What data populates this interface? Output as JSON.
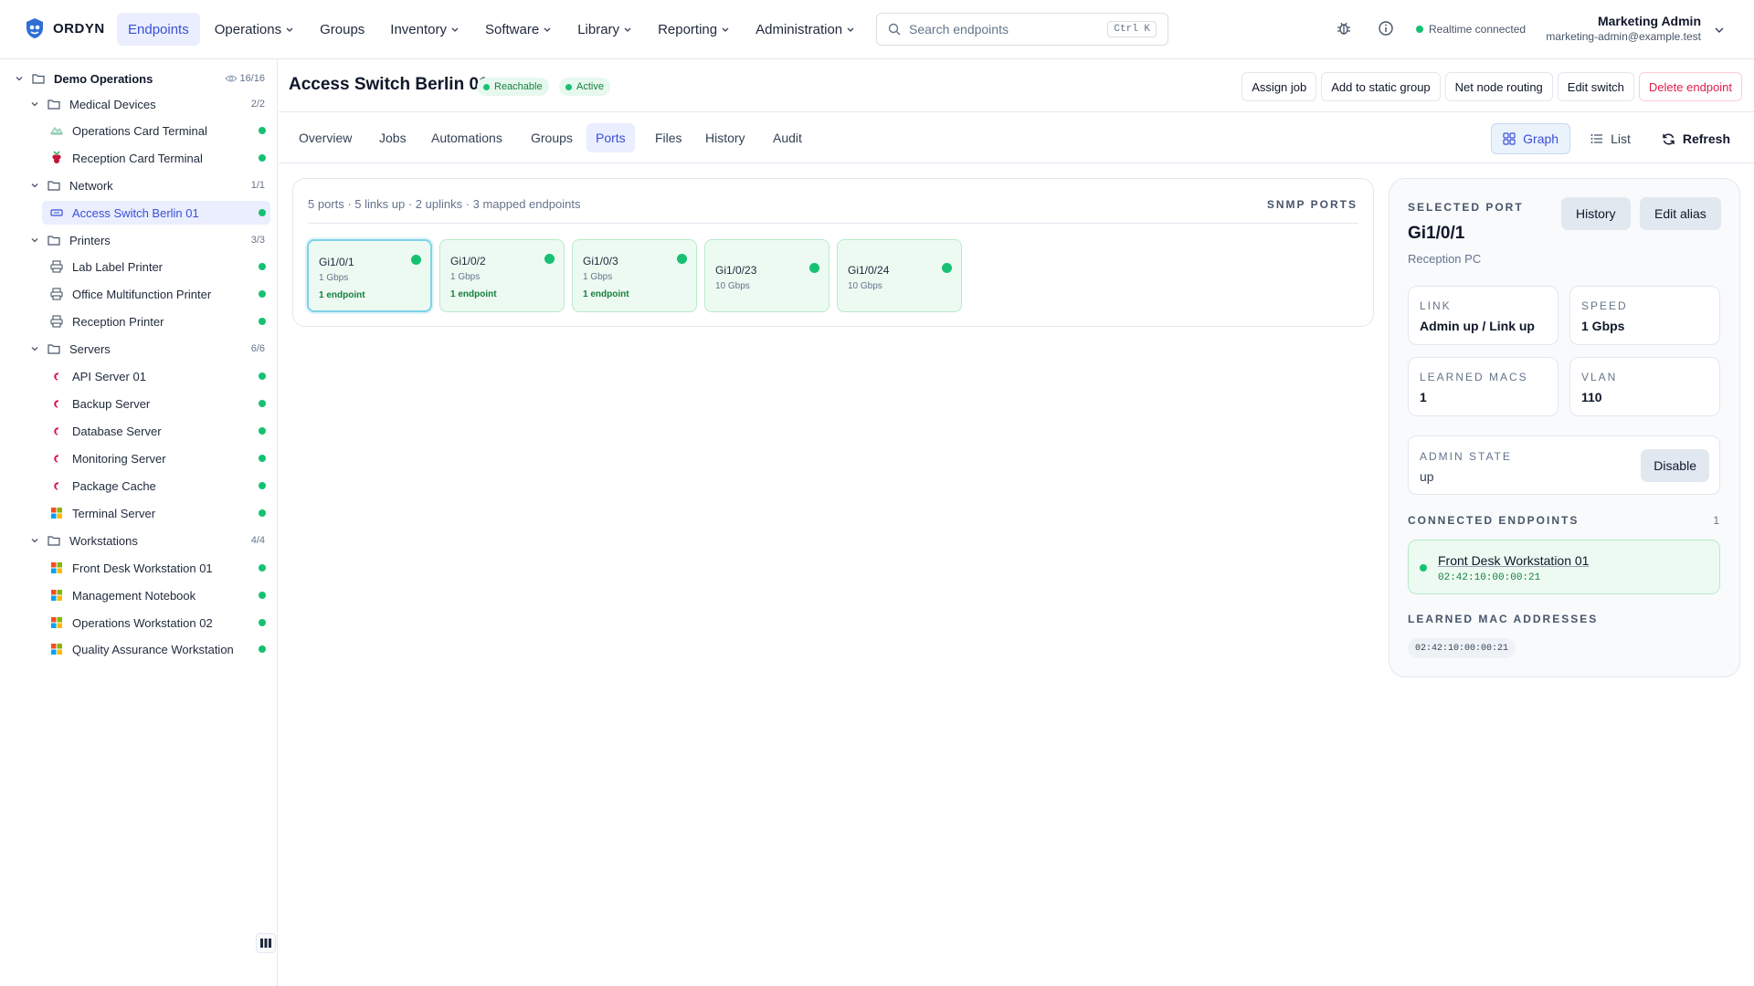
{
  "app": {
    "name": "ORDYN"
  },
  "nav": [
    {
      "label": "Endpoints",
      "active": true,
      "dropdown": false
    },
    {
      "label": "Operations",
      "active": false,
      "dropdown": true
    },
    {
      "label": "Groups",
      "active": false,
      "dropdown": false
    },
    {
      "label": "Inventory",
      "active": false,
      "dropdown": true
    },
    {
      "label": "Software",
      "active": false,
      "dropdown": true
    },
    {
      "label": "Library",
      "active": false,
      "dropdown": true
    },
    {
      "label": "Reporting",
      "active": false,
      "dropdown": true
    },
    {
      "label": "Administration",
      "active": false,
      "dropdown": true
    }
  ],
  "search": {
    "placeholder": "Search endpoints",
    "shortcut": "Ctrl K"
  },
  "status": {
    "realtime": "Realtime connected",
    "color": "#16c172"
  },
  "user": {
    "name": "Marketing Admin",
    "email": "marketing-admin@example.test"
  },
  "tree": {
    "root": {
      "label": "Demo Operations",
      "count": "16/16"
    },
    "groups": [
      {
        "label": "Medical Devices",
        "count": "2/2",
        "items": [
          {
            "label": "Operations Card Terminal",
            "icon": "terminal-icon"
          },
          {
            "label": "Reception Card Terminal",
            "icon": "raspberry-icon"
          }
        ]
      },
      {
        "label": "Network",
        "count": "1/1",
        "items": [
          {
            "label": "Access Switch Berlin 01",
            "icon": "switch-icon",
            "selected": true
          }
        ]
      },
      {
        "label": "Printers",
        "count": "3/3",
        "items": [
          {
            "label": "Lab Label Printer",
            "icon": "printer-icon"
          },
          {
            "label": "Office Multifunction Printer",
            "icon": "printer-icon"
          },
          {
            "label": "Reception Printer",
            "icon": "printer-icon"
          }
        ]
      },
      {
        "label": "Servers",
        "count": "6/6",
        "items": [
          {
            "label": "API Server 01",
            "icon": "debian-icon"
          },
          {
            "label": "Backup Server",
            "icon": "debian-icon"
          },
          {
            "label": "Database Server",
            "icon": "debian-icon"
          },
          {
            "label": "Monitoring Server",
            "icon": "debian-icon"
          },
          {
            "label": "Package Cache",
            "icon": "debian-icon"
          },
          {
            "label": "Terminal Server",
            "icon": "windows-icon"
          }
        ]
      },
      {
        "label": "Workstations",
        "count": "4/4",
        "items": [
          {
            "label": "Front Desk Workstation 01",
            "icon": "windows-icon"
          },
          {
            "label": "Management Notebook",
            "icon": "windows-icon"
          },
          {
            "label": "Operations Workstation 02",
            "icon": "windows-icon"
          },
          {
            "label": "Quality Assurance Workstation",
            "icon": "windows-icon"
          }
        ]
      }
    ]
  },
  "endpoint": {
    "title": "Access Switch Berlin 01",
    "badges": [
      "Reachable",
      "Active"
    ],
    "actions": [
      "Assign job",
      "Add to static group",
      "Net node routing",
      "Edit switch",
      "Delete endpoint"
    ]
  },
  "tabs": [
    "Overview",
    "Jobs",
    "Automations",
    "Groups",
    "Ports",
    "Files",
    "History",
    "Audit"
  ],
  "active_tab": "Ports",
  "view": {
    "graph": "Graph",
    "list": "List",
    "refresh": "Refresh"
  },
  "ports_panel": {
    "summary": "5 ports · 5 links up · 2 uplinks · 3 mapped endpoints",
    "heading": "SNMP PORTS",
    "ports": [
      {
        "name": "Gi1/0/1",
        "speed": "1 Gbps",
        "endpoints": "1 endpoint",
        "selected": true
      },
      {
        "name": "Gi1/0/2",
        "speed": "1 Gbps",
        "endpoints": "1 endpoint"
      },
      {
        "name": "Gi1/0/3",
        "speed": "1 Gbps",
        "endpoints": "1 endpoint"
      },
      {
        "name": "Gi1/0/23",
        "speed": "10 Gbps",
        "endpoints": ""
      },
      {
        "name": "Gi1/0/24",
        "speed": "10 Gbps",
        "endpoints": ""
      }
    ]
  },
  "selected_port": {
    "heading": "SELECTED PORT",
    "name": "Gi1/0/1",
    "alias": "Reception PC",
    "history_btn": "History",
    "edit_alias_btn": "Edit alias",
    "link_label": "LINK",
    "link_value": "Admin up / Link up",
    "speed_label": "SPEED",
    "speed_value": "1 Gbps",
    "macs_label": "LEARNED MACS",
    "macs_value": "1",
    "vlan_label": "VLAN",
    "vlan_value": "110",
    "admin_label": "ADMIN STATE",
    "admin_value": "up",
    "disable_btn": "Disable",
    "connected_label": "CONNECTED ENDPOINTS",
    "connected_count": "1",
    "connected": {
      "name": "Front Desk Workstation 01",
      "mac": "02:42:10:00:00:21"
    },
    "learned_label": "LEARNED MAC ADDRESSES",
    "learned_mac": "02:42:10:00:00:21"
  }
}
